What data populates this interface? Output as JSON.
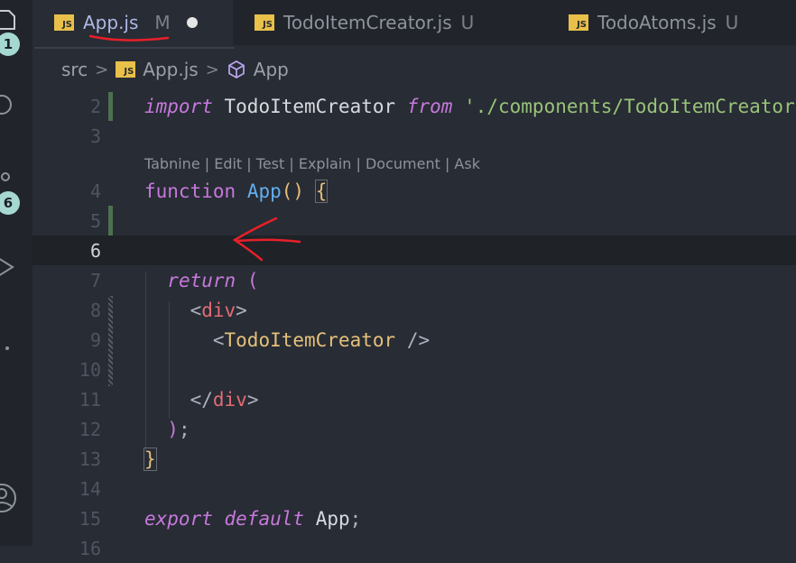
{
  "activity_bar": {
    "badges": [
      "1",
      "6"
    ]
  },
  "tabs": [
    {
      "icon": "JS",
      "name": "App.js",
      "status": "M",
      "dirty": true
    },
    {
      "icon": "JS",
      "name": "TodoItemCreator.js",
      "status": "U"
    },
    {
      "icon": "JS",
      "name": "TodoAtoms.js",
      "status": "U"
    }
  ],
  "breadcrumb": {
    "folder": "src",
    "sep": ">",
    "file_icon": "JS",
    "file": "App.js",
    "symbol": "App"
  },
  "codelens": "Tabnine | Edit | Test | Explain | Document | Ask",
  "lines": [
    {
      "n": "2",
      "code": "import TodoItemCreator from './components/TodoItemCreator'"
    },
    {
      "n": "3",
      "code": ""
    },
    {
      "n": "4",
      "code": "function App() {"
    },
    {
      "n": "5",
      "code": ""
    },
    {
      "n": "6",
      "code": ""
    },
    {
      "n": "7",
      "code": "  return ("
    },
    {
      "n": "8",
      "code": "    <div>"
    },
    {
      "n": "9",
      "code": "      <TodoItemCreator />"
    },
    {
      "n": "10",
      "code": ""
    },
    {
      "n": "11",
      "code": "    </div>"
    },
    {
      "n": "12",
      "code": "  );"
    },
    {
      "n": "13",
      "code": "}"
    },
    {
      "n": "14",
      "code": ""
    },
    {
      "n": "15",
      "code": "export default App;"
    },
    {
      "n": "16",
      "code": ""
    }
  ],
  "colors": {
    "editor_bg": "#282c34",
    "keyword": "#c678dd",
    "function": "#61afef",
    "string": "#98c379",
    "tag": "#e06c75",
    "component": "#e5c07b",
    "annotation": "#e8202a"
  }
}
